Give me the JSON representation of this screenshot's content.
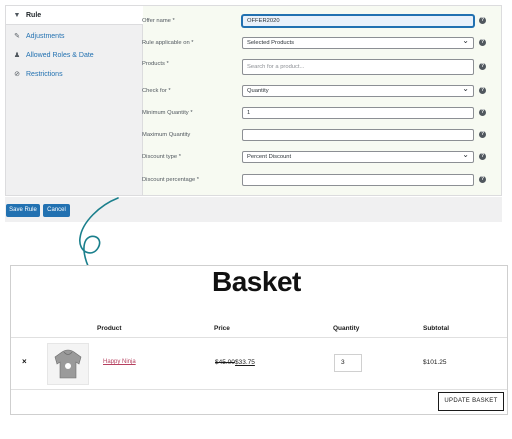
{
  "sidebar": {
    "items": [
      {
        "label": "Rule",
        "icon": "funnel-icon",
        "active": true
      },
      {
        "label": "Adjustments",
        "icon": "pencil-icon",
        "active": false
      },
      {
        "label": "Allowed Roles & Date",
        "icon": "person-icon",
        "active": false
      },
      {
        "label": "Restrictions",
        "icon": "ban-icon",
        "active": false
      }
    ]
  },
  "form": {
    "offer_name": {
      "label": "Offer name *",
      "value": "OFFER2020"
    },
    "rule_applicable": {
      "label": "Rule applicable on *",
      "value": "Selected Products"
    },
    "products": {
      "label": "Products *",
      "placeholder": "Search for a product..."
    },
    "check_for": {
      "label": "Check for *",
      "value": "Quantity"
    },
    "min_qty": {
      "label": "Minimum Quantity *",
      "value": "1"
    },
    "max_qty": {
      "label": "Maximum Quantity",
      "value": ""
    },
    "discount_type": {
      "label": "Discount type *",
      "value": "Percent Discount"
    },
    "discount_percentage": {
      "label": "Discount percentage *",
      "value": ""
    },
    "help_glyph": "?"
  },
  "actions": {
    "save_label": "Save Rule",
    "cancel_label": "Cancel"
  },
  "basket": {
    "title": "Basket",
    "headers": {
      "product": "Product",
      "price": "Price",
      "quantity": "Quantity",
      "subtotal": "Subtotal"
    },
    "row": {
      "remove": "×",
      "product_name": "Happy Ninja",
      "old_price": "$45.00",
      "new_price": "$33.75",
      "quantity": "3",
      "subtotal": "$101.25"
    },
    "update_label": "UPDATE BASKET"
  },
  "colors": {
    "primary": "#2271b1",
    "accent_teal": "#1a7f8c",
    "link": "#b6405f"
  }
}
